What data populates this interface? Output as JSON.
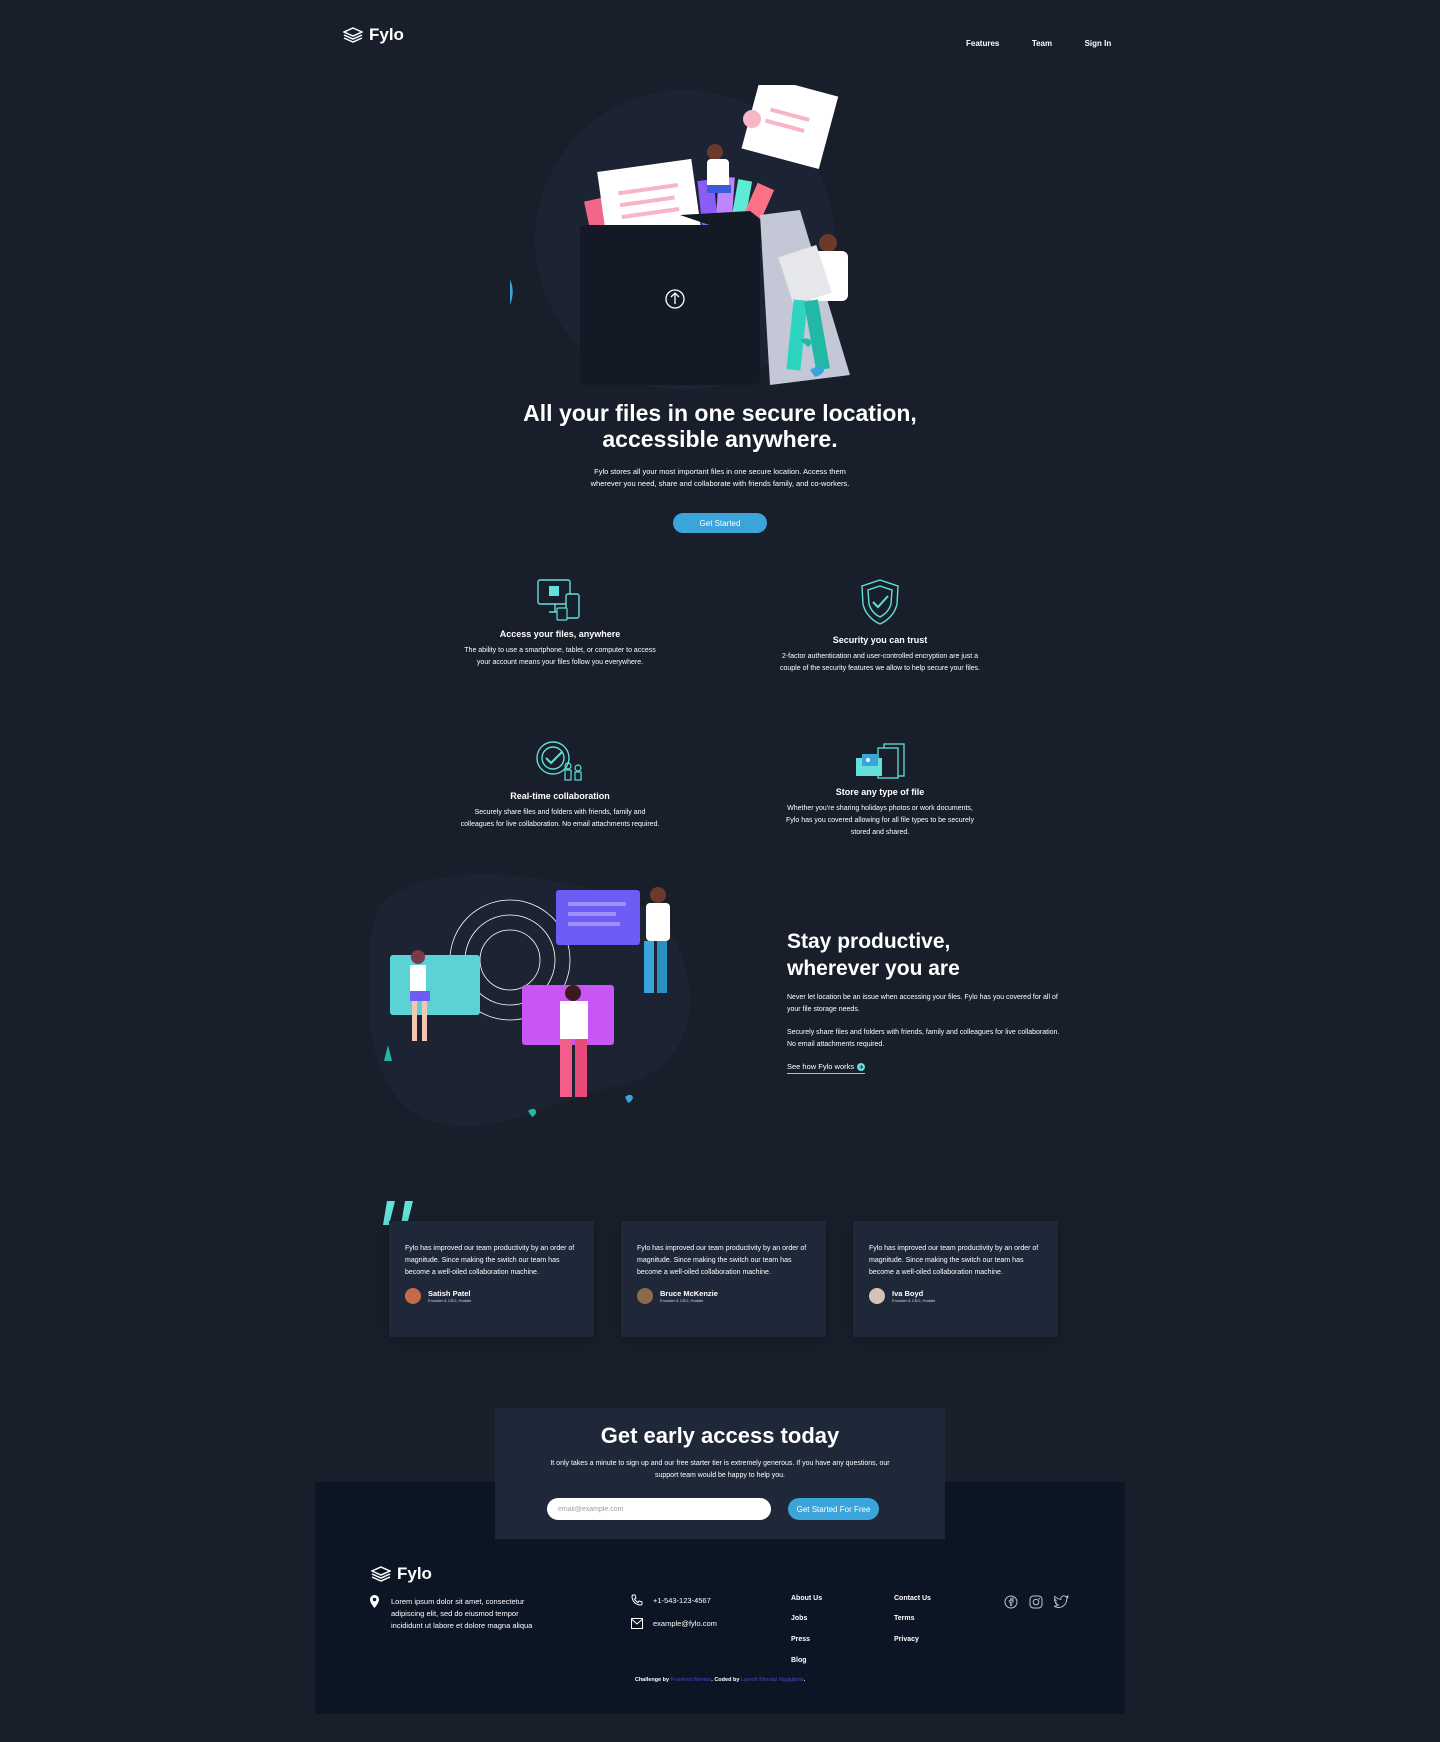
{
  "header": {
    "logo_text": "Fylo",
    "nav": [
      "Features",
      "Team",
      "Sign In"
    ]
  },
  "hero": {
    "title_line1": "All your files in one secure location,",
    "title_line2": "accessible anywhere.",
    "text": "Fylo stores all your most important files in one secure location. Access them wherever you need, share and collaborate with friends family, and co-workers.",
    "button": "Get Started"
  },
  "features": [
    {
      "icon": "devices-icon",
      "title": "Access your files, anywhere",
      "text": "The ability to use a smartphone, tablet, or computer to access your account means your files follow you everywhere."
    },
    {
      "icon": "shield-icon",
      "title": "Security you can trust",
      "text": "2-factor authentication and user-controlled encryption are just a couple of the security features we allow to help secure your files."
    },
    {
      "icon": "collaboration-icon",
      "title": "Real-time collaboration",
      "text": "Securely share files and folders with friends, family and colleagues for live collaboration. No email attachments required."
    },
    {
      "icon": "folders-icon",
      "title": "Store any type of file",
      "text": "Whether you're sharing holidays photos or work documents, Fylo has you covered allowing for all file types to be securely stored and shared."
    }
  ],
  "productive": {
    "title_line1": "Stay productive,",
    "title_line2": "wherever you are",
    "p1": "Never let location be an issue when accessing your files. Fylo has you covered for all of your file storage needs.",
    "p2": "Securely share files and folders with friends, family and colleagues for live collaboration. No email attachments required.",
    "link": "See how Fylo works"
  },
  "testimonials": [
    {
      "text": "Fylo has improved our team productivity by an order of magnitude. Since making the switch our team has become a well-oiled collaboration machine.",
      "name": "Satish Patel",
      "role": "Founder & CEO, Huddle"
    },
    {
      "text": "Fylo has improved our team productivity by an order of magnitude. Since making the switch our team has become a well-oiled collaboration machine.",
      "name": "Bruce McKenzie",
      "role": "Founder & CEO, Huddle"
    },
    {
      "text": "Fylo has improved our team productivity by an order of magnitude. Since making the switch our team has become a well-oiled collaboration machine.",
      "name": "Iva Boyd",
      "role": "Founder & CEO, Huddle"
    }
  ],
  "cta": {
    "title": "Get early access today",
    "text": "It only takes a minute to sign up and our free starter tier is extremely generous. If you have any questions, our support team would be happy to help you.",
    "placeholder": "email@example.com",
    "button": "Get Started For Free"
  },
  "footer": {
    "logo_text": "Fylo",
    "address": "Lorem ipsum dolor sit amet, consectetur adipiscing elit, sed do eiusmod tempor incididunt ut labore et dolore magna aliqua",
    "phone": "+1-543-123-4567",
    "email": "example@fylo.com",
    "links_col1": [
      "About Us",
      "Jobs",
      "Press",
      "Blog"
    ],
    "links_col2": [
      "Contact Us",
      "Terms",
      "Privacy"
    ],
    "social": [
      "facebook-icon",
      "instagram-icon",
      "twitter-icon"
    ],
    "attribution": {
      "challenge_prefix": "Challenge by",
      "challenge_link": "Frontend Mentor",
      "coded_prefix": ". Coded by",
      "coded_link": "Laresh Mondal Nagigbola",
      "suffix": "."
    }
  },
  "colors": {
    "background": "#181e2a",
    "card": "#1f2839",
    "footer": "#0c1524",
    "accent": "#3ba4d9",
    "teal": "#62e0d9",
    "link_blue": "#3c4ec7"
  }
}
